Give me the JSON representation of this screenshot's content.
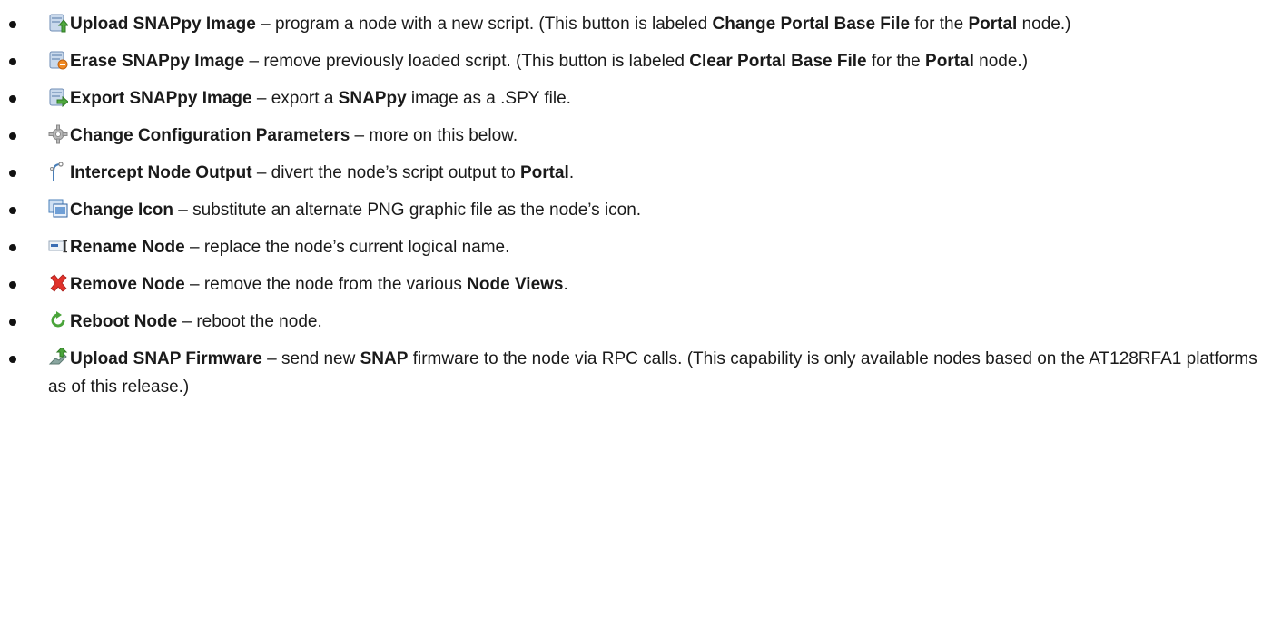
{
  "items": [
    {
      "icon": "upload-script-icon",
      "segments": [
        {
          "t": "Upload SNAPpy Image",
          "b": true
        },
        {
          "t": " – program a node with a new script. (This button is labeled ",
          "b": false
        },
        {
          "t": "Change Portal Base File",
          "b": true
        },
        {
          "t": " for the ",
          "b": false
        },
        {
          "t": "Portal",
          "b": true
        },
        {
          "t": " node.)",
          "b": false
        }
      ]
    },
    {
      "icon": "erase-script-icon",
      "segments": [
        {
          "t": "Erase SNAPpy Image",
          "b": true
        },
        {
          "t": " – remove previously loaded script. (This button is labeled ",
          "b": false
        },
        {
          "t": "Clear Portal Base File",
          "b": true
        },
        {
          "t": " for the ",
          "b": false
        },
        {
          "t": "Portal",
          "b": true
        },
        {
          "t": " node.)",
          "b": false
        }
      ]
    },
    {
      "icon": "export-script-icon",
      "segments": [
        {
          "t": "Export SNAPpy Image",
          "b": true
        },
        {
          "t": " – export a ",
          "b": false
        },
        {
          "t": "SNAPpy",
          "b": true
        },
        {
          "t": " image as a .SPY file.",
          "b": false
        }
      ]
    },
    {
      "icon": "gear-icon",
      "segments": [
        {
          "t": "Change Configuration Parameters",
          "b": true
        },
        {
          "t": " – more on this below.",
          "b": false
        }
      ]
    },
    {
      "icon": "intercept-output-icon",
      "segments": [
        {
          "t": "Intercept Node Output",
          "b": true
        },
        {
          "t": " – divert the node’s script output to ",
          "b": false
        },
        {
          "t": "Portal",
          "b": true
        },
        {
          "t": ".",
          "b": false
        }
      ]
    },
    {
      "icon": "change-icon-icon",
      "segments": [
        {
          "t": "Change Icon",
          "b": true
        },
        {
          "t": " – substitute an alternate PNG graphic file as the node’s icon.",
          "b": false
        }
      ]
    },
    {
      "icon": "rename-icon",
      "segments": [
        {
          "t": "Rename Node",
          "b": true
        },
        {
          "t": " – replace the node’s current logical name.",
          "b": false
        }
      ]
    },
    {
      "icon": "remove-x-icon",
      "segments": [
        {
          "t": "Remove Node",
          "b": true
        },
        {
          "t": " – remove the node from the various ",
          "b": false
        },
        {
          "t": "Node Views",
          "b": true
        },
        {
          "t": ".",
          "b": false
        }
      ]
    },
    {
      "icon": "reboot-icon",
      "segments": [
        {
          "t": "Reboot Node",
          "b": true
        },
        {
          "t": " – reboot the node.",
          "b": false
        }
      ]
    },
    {
      "icon": "upload-firmware-icon",
      "segments": [
        {
          "t": "Upload SNAP Firmware",
          "b": true
        },
        {
          "t": " – send new ",
          "b": false
        },
        {
          "t": "SNAP",
          "b": true
        },
        {
          "t": " firmware to the node via RPC calls. (This capability is only available nodes based on the AT128RFA1 platforms as of this release.)",
          "b": false
        }
      ]
    }
  ]
}
